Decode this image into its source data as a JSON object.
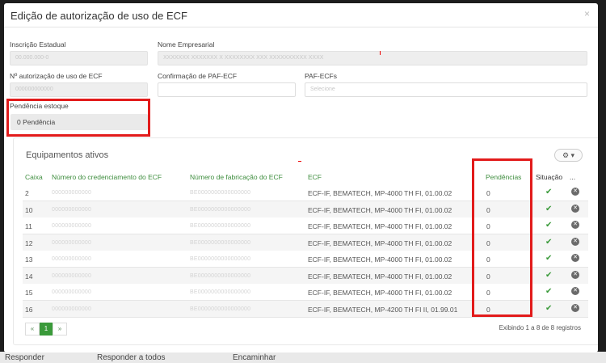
{
  "modal": {
    "title": "Edição de autorização de uso de ECF",
    "close_glyph": "×"
  },
  "form": {
    "inscricao_label": "Inscrição Estadual",
    "inscricao_value": "00.000.000-0",
    "nome_label": "Nome Empresarial",
    "nome_value": "XXXXXXX XXXXXXX X XXXXXXXX XXX XXXXXXXXXX XXXX",
    "num_aut_label": "Nº autorização de uso de ECF",
    "num_aut_value": "000000000000",
    "confirm_label": "Confirmação de PAF-ECF",
    "paf_label": "PAF-ECFs",
    "paf_placeholder": "Selecione",
    "pendencia_label": "Pendência estoque",
    "pendencia_value": "0  Pendência"
  },
  "table": {
    "title": "Equipamentos ativos",
    "gear_label": "⚙ ▾",
    "headers": {
      "caixa": "Caixa",
      "credenciamento": "Número do credenciamento do ECF",
      "fabricacao": "Número de fabricação do ECF",
      "ecf": "ECF",
      "pendencias": "Pendências",
      "situacao": "Situação",
      "acoes": "..."
    },
    "rows": [
      {
        "caixa": "2",
        "cred": "000000000000",
        "fab": "BE0000000000000000",
        "ecf": "ECF-IF, BEMATECH, MP-4000 TH FI, 01.00.02",
        "pend": "0"
      },
      {
        "caixa": "10",
        "cred": "000000000000",
        "fab": "BE0000000000000000",
        "ecf": "ECF-IF, BEMATECH, MP-4000 TH FI, 01.00.02",
        "pend": "0"
      },
      {
        "caixa": "11",
        "cred": "000000000000",
        "fab": "BE0000000000000000",
        "ecf": "ECF-IF, BEMATECH, MP-4000 TH FI, 01.00.02",
        "pend": "0"
      },
      {
        "caixa": "12",
        "cred": "000000000000",
        "fab": "BE0000000000000000",
        "ecf": "ECF-IF, BEMATECH, MP-4000 TH FI, 01.00.02",
        "pend": "0"
      },
      {
        "caixa": "13",
        "cred": "000000000000",
        "fab": "BE0000000000000000",
        "ecf": "ECF-IF, BEMATECH, MP-4000 TH FI, 01.00.02",
        "pend": "0"
      },
      {
        "caixa": "14",
        "cred": "000000000000",
        "fab": "BE0000000000000000",
        "ecf": "ECF-IF, BEMATECH, MP-4000 TH FI, 01.00.02",
        "pend": "0"
      },
      {
        "caixa": "15",
        "cred": "000000000000",
        "fab": "BE0000000000000000",
        "ecf": "ECF-IF, BEMATECH, MP-4000 TH FI, 01.00.02",
        "pend": "0"
      },
      {
        "caixa": "16",
        "cred": "000000000000",
        "fab": "BE0000000000000000",
        "ecf": "ECF-IF, BEMATECH, MP-4200 TH FI II, 01.99.01",
        "pend": "0"
      }
    ],
    "summary": "Exibindo 1 a 8 de 8 registros"
  },
  "pager": {
    "prev": "«",
    "page": "1",
    "next": "»"
  },
  "underlay": {
    "item1": "Responder",
    "item2": "Responder a todos",
    "item3": "Encaminhar"
  },
  "colors": {
    "accent_green": "#3a9a3a",
    "highlight_red": "#e21b1b"
  }
}
